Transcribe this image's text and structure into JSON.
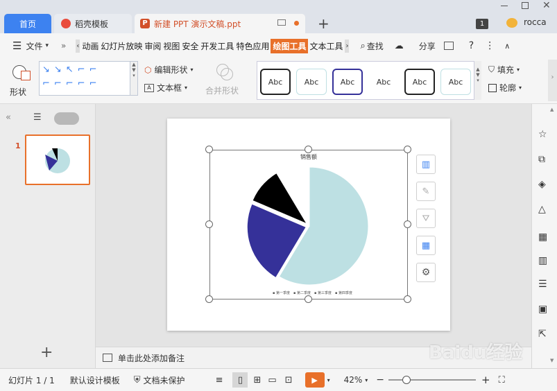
{
  "tabs": {
    "home": "首页",
    "daoke": "稻壳模板",
    "doc": "新建 PPT 演示文稿.ppt",
    "user": "rocca",
    "badge": "1"
  },
  "menu": {
    "file": "文件",
    "items": [
      "动画",
      "幻灯片放映",
      "审阅",
      "视图",
      "安全",
      "开发工具",
      "特色应用",
      "绘图工具",
      "文本工具"
    ],
    "search": "查找",
    "share": "分享"
  },
  "ribbon": {
    "shape": "形状",
    "edit_shape": "编辑形状",
    "textbox": "文本框",
    "merge": "合并形状",
    "styles": [
      "Abc",
      "Abc",
      "Abc",
      "Abc",
      "Abc",
      "Abc"
    ],
    "fill": "填充",
    "outline": "轮廓"
  },
  "slide": {
    "number": "1",
    "chart_title": "销售额",
    "legend": [
      "第一季度",
      "第二季度",
      "第三季度",
      "第四季度"
    ]
  },
  "chart_data": {
    "type": "pie",
    "title": "销售额",
    "categories": [
      "第一季度",
      "第二季度",
      "第三季度",
      "第四季度"
    ],
    "values": [
      8.2,
      3.2,
      1.4,
      1.2
    ],
    "colors": [
      "#bde0e3",
      "#353199",
      "#000000",
      "#ffffff"
    ]
  },
  "notes": {
    "placeholder": "单击此处添加备注"
  },
  "status": {
    "slide": "幻灯片 1 / 1",
    "template": "默认设计模板",
    "protect": "文档未保护",
    "zoom": "42%"
  },
  "watermark": "Baidu经验"
}
